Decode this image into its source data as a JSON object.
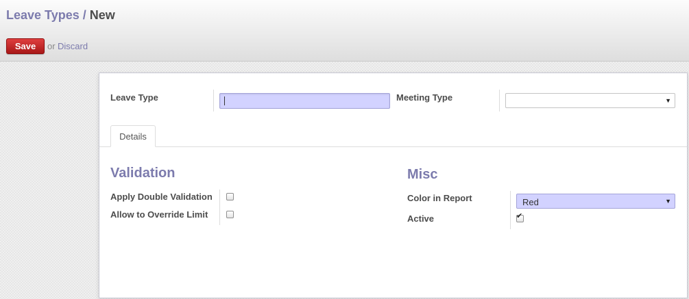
{
  "breadcrumb": {
    "parent": "Leave Types",
    "separator": "/",
    "current": "New"
  },
  "toolbar": {
    "save_label": "Save",
    "or_text": "or",
    "discard_label": "Discard"
  },
  "form": {
    "leave_type_label": "Leave Type",
    "leave_type_value": "",
    "meeting_type_label": "Meeting Type",
    "meeting_type_value": ""
  },
  "tabs": [
    {
      "label": "Details",
      "active": true
    }
  ],
  "validation": {
    "title": "Validation",
    "fields": [
      {
        "label": "Apply Double Validation",
        "checked": false
      },
      {
        "label": "Allow to Override Limit",
        "checked": false
      }
    ]
  },
  "misc": {
    "title": "Misc",
    "color_label": "Color in Report",
    "color_value": "Red",
    "active_label": "Active",
    "active_checked": true
  },
  "icons": {
    "dropdown": "chevron-down-icon",
    "check": "checkmark-icon"
  },
  "colors": {
    "accent": "#7c7bad",
    "save_button": "#c02323",
    "input_highlight": "#d2d2ff"
  }
}
